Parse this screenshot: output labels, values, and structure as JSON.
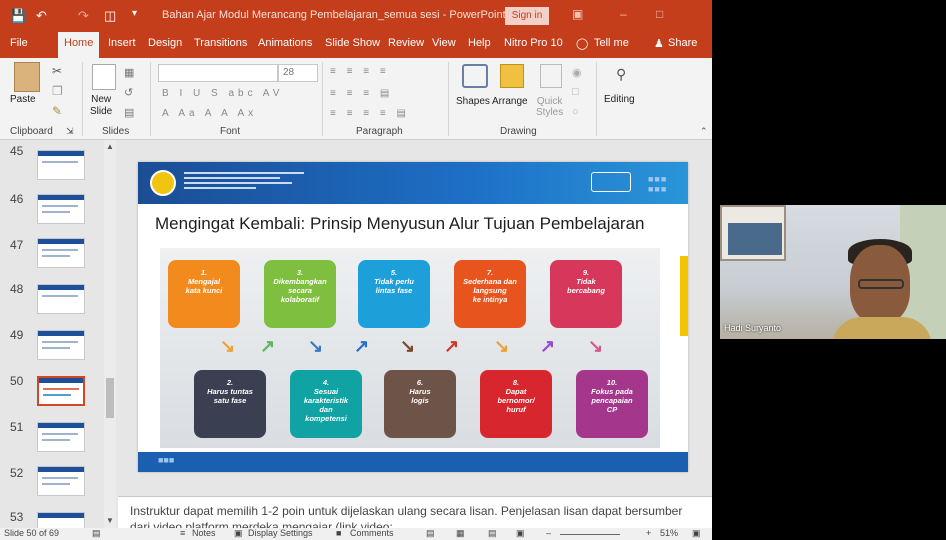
{
  "titlebar": {
    "window_title": "Bahan Ajar Modul Merancang Pembelajaran_semua sesi  -  PowerPoint",
    "sign_in": "Sign in"
  },
  "tabs": [
    "File",
    "Home",
    "Insert",
    "Design",
    "Transitions",
    "Animations",
    "Slide Show",
    "Review",
    "View",
    "Help",
    "Nitro Pro 10",
    "Tell me",
    "Share"
  ],
  "active_tab": "Home",
  "ribbon": {
    "paste": "Paste",
    "new_slide": "New\nSlide",
    "font_size": "28",
    "shapes": "Shapes",
    "arrange": "Arrange",
    "quick_styles": "Quick\nStyles",
    "editing": "Editing",
    "groups": [
      "Clipboard",
      "Slides",
      "Font",
      "Paragraph",
      "Drawing"
    ]
  },
  "thumbnails": [
    "45",
    "46",
    "47",
    "48",
    "49",
    "50",
    "51",
    "52",
    "53"
  ],
  "selected_thumbnail": "50",
  "slide": {
    "title": "Mengingat Kembali: Prinsip Menyusun Alur Tujuan Pembelajaran",
    "cards": [
      {
        "text": "1.\nMengajal\nkata kunci",
        "color": "#f28a1e"
      },
      {
        "text": "3.\nDikembangkan\nsecara\nkolaboratif",
        "color": "#7fbf3f"
      },
      {
        "text": "5.\nTidak perlu\nlintas fase",
        "color": "#1d9fd9"
      },
      {
        "text": "7.\nSederhana dan\nlangsung\nke intinya",
        "color": "#e8541e"
      },
      {
        "text": "9.\nTidak\nbercabang",
        "color": "#d6375a"
      },
      {
        "text": "2.\nHarus tuntas\nsatu fase",
        "color": "#3a3f52"
      },
      {
        "text": "4.\nSesuai\nkarakteristik\ndan\nkompetensi",
        "color": "#11a3a3"
      },
      {
        "text": "6.\nHarus\nlogis",
        "color": "#6e5448"
      },
      {
        "text": "8.\nDapat\nbernomor/\nhuruf",
        "color": "#d8262e"
      },
      {
        "text": "10.\nFokus pada\npencapaian\nCP",
        "color": "#a4368c"
      }
    ]
  },
  "notes": "Instruktur dapat memilih 1-2 poin untuk dijelaskan ulang secara lisan. Penjelasan lisan dapat bersumber dari video platform merdeka mengajar (link video:",
  "status": {
    "slide_of": "Slide 50 of 69",
    "notes": "Notes",
    "display_settings": "Display Settings",
    "comments": "Comments",
    "zoom": "51%"
  },
  "video": {
    "participant_name": "Hadi Suryanto"
  }
}
